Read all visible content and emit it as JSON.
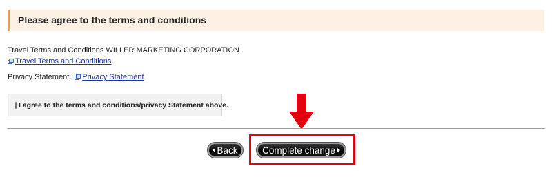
{
  "header": {
    "title": "Please agree to the terms and conditions",
    "accent_color": "#e8a33d",
    "background_color": "#fdf1e3"
  },
  "terms": {
    "line_text": "Travel Terms and Conditions WILLER MARKETING CORPORATION",
    "link_label": "Travel Terms and Conditions",
    "link_icon": "external-link-icon"
  },
  "privacy": {
    "label": "Privacy Statement",
    "link_label": "Privacy Statement",
    "link_icon": "external-link-icon"
  },
  "agreement": {
    "checkbox_label": "I agree to the terms and conditions/privacy Statement above.",
    "checked": false
  },
  "actions": {
    "back_label": "Back",
    "complete_label": "Complete change",
    "highlight_color": "#e3000f",
    "arrow_icon": "down-arrow-icon"
  }
}
